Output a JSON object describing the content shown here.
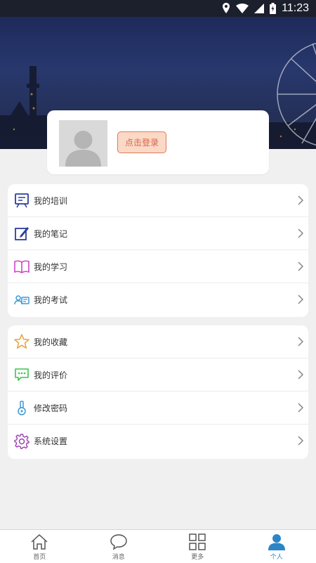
{
  "status_bar": {
    "time": "11:23"
  },
  "profile": {
    "login_button": "点击登录"
  },
  "menu_group_1": [
    {
      "label": "我的培训",
      "icon": "training-board-icon"
    },
    {
      "label": "我的笔记",
      "icon": "note-pen-icon"
    },
    {
      "label": "我的学习",
      "icon": "open-book-icon"
    },
    {
      "label": "我的考试",
      "icon": "exam-icon"
    }
  ],
  "menu_group_2": [
    {
      "label": "我的收藏",
      "icon": "star-icon"
    },
    {
      "label": "我的评价",
      "icon": "comment-icon"
    },
    {
      "label": "修改密码",
      "icon": "key-icon"
    },
    {
      "label": "系统设置",
      "icon": "gear-icon"
    }
  ],
  "tab_bar": [
    {
      "label": "首页",
      "icon": "home-icon"
    },
    {
      "label": "消息",
      "icon": "message-icon"
    },
    {
      "label": "更多",
      "icon": "grid-icon"
    },
    {
      "label": "个人",
      "icon": "person-icon",
      "active": true
    }
  ],
  "colors": {
    "accent": "#2a86c8",
    "login_button_bg": "#fbd9c6",
    "login_button_border": "#e07a5a"
  }
}
